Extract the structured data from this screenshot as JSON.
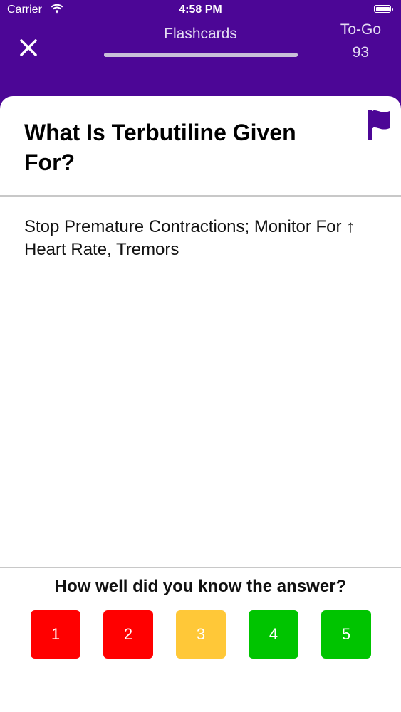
{
  "status_bar": {
    "carrier": "Carrier",
    "time": "4:58 PM",
    "wifi_icon": "wifi-icon",
    "battery_icon": "battery-icon"
  },
  "header": {
    "title": "Flashcards",
    "close_icon": "close-icon",
    "progress_fraction": 1.0,
    "to_go_label": "To-Go",
    "to_go_count": "93"
  },
  "card": {
    "question": "What Is Terbutiline Given For?",
    "answer": "Stop Premature Contractions; Monitor For ↑ Heart Rate, Tremors",
    "flag_icon": "flag-icon"
  },
  "rating": {
    "prompt": "How well did you know the answer?",
    "buttons": [
      {
        "label": "1",
        "color": "#ff0000"
      },
      {
        "label": "2",
        "color": "#ff0000"
      },
      {
        "label": "3",
        "color": "#ffc838"
      },
      {
        "label": "4",
        "color": "#00c400"
      },
      {
        "label": "5",
        "color": "#00c400"
      }
    ]
  },
  "colors": {
    "brand": "#4c0696",
    "flag": "#4c0696"
  }
}
